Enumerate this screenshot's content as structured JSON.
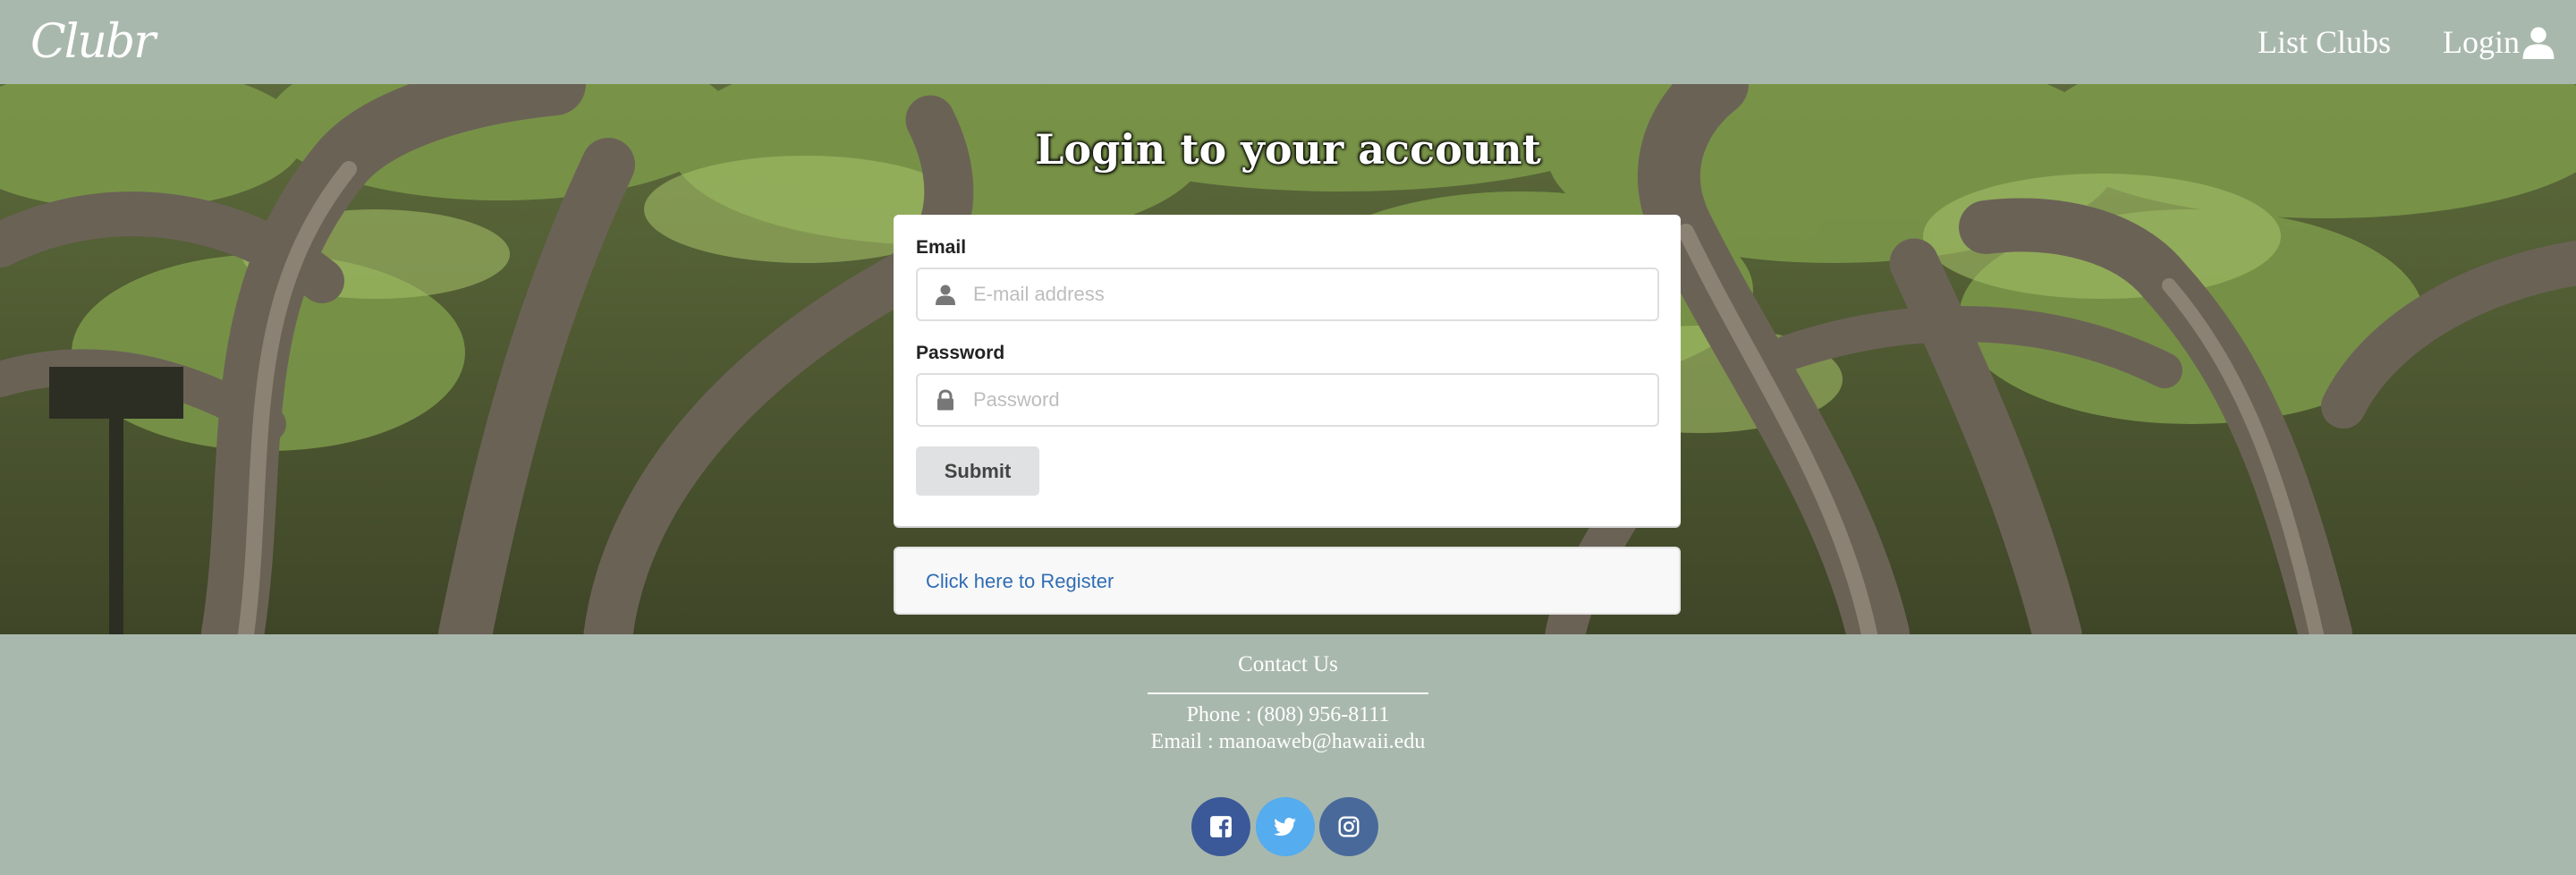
{
  "navbar": {
    "brand": "Clubr",
    "links": [
      {
        "label": "List Clubs"
      },
      {
        "label": "Login"
      }
    ],
    "login_icon": "user-icon"
  },
  "login": {
    "title": "Login to your account",
    "email_label": "Email",
    "email_placeholder": "E-mail address",
    "email_icon": "user-icon",
    "password_label": "Password",
    "password_placeholder": "Password",
    "password_icon": "lock-icon",
    "submit_label": "Submit",
    "register_link": "Click here to Register"
  },
  "footer": {
    "contact_title": "Contact Us",
    "phone": "Phone : (808) 956-8111",
    "email": "Email : manoaweb@hawaii.edu",
    "social": [
      {
        "icon": "facebook-icon",
        "color": "#3b5998"
      },
      {
        "icon": "twitter-icon",
        "color": "#55acee"
      },
      {
        "icon": "instagram-icon",
        "color": "#49699a"
      }
    ]
  },
  "colors": {
    "nav_background": "#a9b8ad",
    "link": "#2f6db3",
    "button": "#e0e1e2"
  }
}
